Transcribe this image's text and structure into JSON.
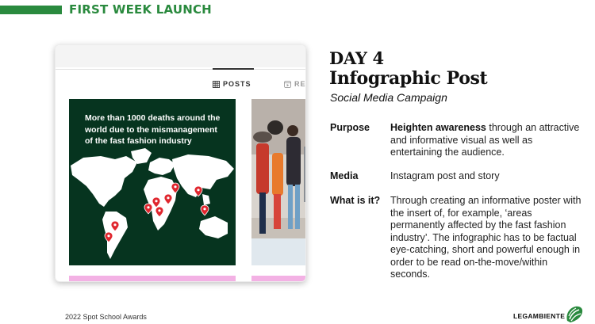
{
  "header": {
    "title": "FIRST WEEK LAUNCH"
  },
  "phone": {
    "tabs": [
      {
        "label": "POSTS",
        "icon": "grid-icon",
        "active": true
      },
      {
        "label": "REE",
        "icon": "reels-icon",
        "active": false
      }
    ],
    "post": {
      "headline": "More than 1000 deaths around the world due to the mismanagement of the fast fashion industry"
    }
  },
  "slide": {
    "day": "DAY 4",
    "title": "Infographic Post",
    "subtitle": "Social Media Campaign",
    "rows": [
      {
        "label": "Purpose",
        "highlight": "Heighten awareness",
        "text": " through an attractive and informative visual as well as entertaining the audience."
      },
      {
        "label": "Media",
        "text": "Instagram post and story"
      },
      {
        "label": "What is it?",
        "text": "Through creating an informative poster with the insert of, for example, ‘areas permanently affected by the fast fashion industry’. The infographic has to be factual eye-catching, short and powerful enough in order to be read on-the-move/within seconds."
      }
    ]
  },
  "footer": {
    "left": "2022 Spot School Awards",
    "brand": "LEGAMBIENTE"
  },
  "colors": {
    "accent_green": "#2a8a3e",
    "post_bg": "#06341f",
    "pin_red": "#e0262e",
    "pink": "#f3b1e4"
  }
}
